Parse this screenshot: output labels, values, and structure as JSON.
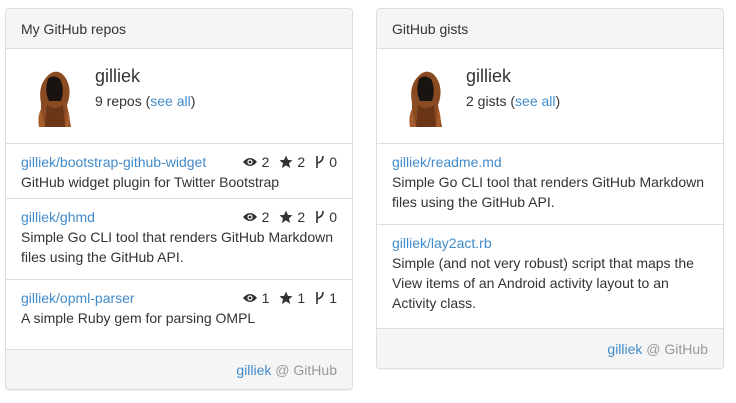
{
  "repos_panel": {
    "heading": "My GitHub repos",
    "profile": {
      "username": "gilliek",
      "count_text": "9 repos",
      "see_all_open": " (",
      "see_all_label": "see all",
      "see_all_close": ")"
    },
    "repos": [
      {
        "name": "gilliek/bootstrap-github-widget",
        "description": "GitHub widget plugin for Twitter Bootstrap",
        "watchers": "2",
        "stars": "2",
        "forks": "0"
      },
      {
        "name": "gilliek/ghmd",
        "description": "Simple Go CLI tool that renders GitHub Markdown files using the GitHub API.",
        "watchers": "2",
        "stars": "2",
        "forks": "0"
      },
      {
        "name": "gilliek/opml-parser",
        "description": "A simple Ruby gem for parsing OMPL",
        "watchers": "1",
        "stars": "1",
        "forks": "1"
      }
    ],
    "footer": {
      "user_link": "gilliek",
      "suffix": " @ GitHub"
    }
  },
  "gists_panel": {
    "heading": "GitHub gists",
    "profile": {
      "username": "gilliek",
      "count_text": "2 gists",
      "see_all_open": " (",
      "see_all_label": "see all",
      "see_all_close": ")"
    },
    "gists": [
      {
        "name": "gilliek/readme.md",
        "description": "Simple Go CLI tool that renders GitHub Markdown files using the GitHub API."
      },
      {
        "name": "gilliek/lay2act.rb",
        "description": "Simple (and not very robust) script that maps the View items of an Android activity layout to an Activity class."
      }
    ],
    "footer": {
      "user_link": "gilliek",
      "suffix": " @ GitHub"
    }
  },
  "colors": {
    "link": "#428bca",
    "text": "#333333",
    "muted": "#999999",
    "panel_heading_bg": "#f5f5f5",
    "border": "#dddddd"
  },
  "icons": {
    "watchers": "eye-icon",
    "stars": "star-icon",
    "forks": "fork-icon",
    "avatar": "hooded-figure-avatar"
  }
}
